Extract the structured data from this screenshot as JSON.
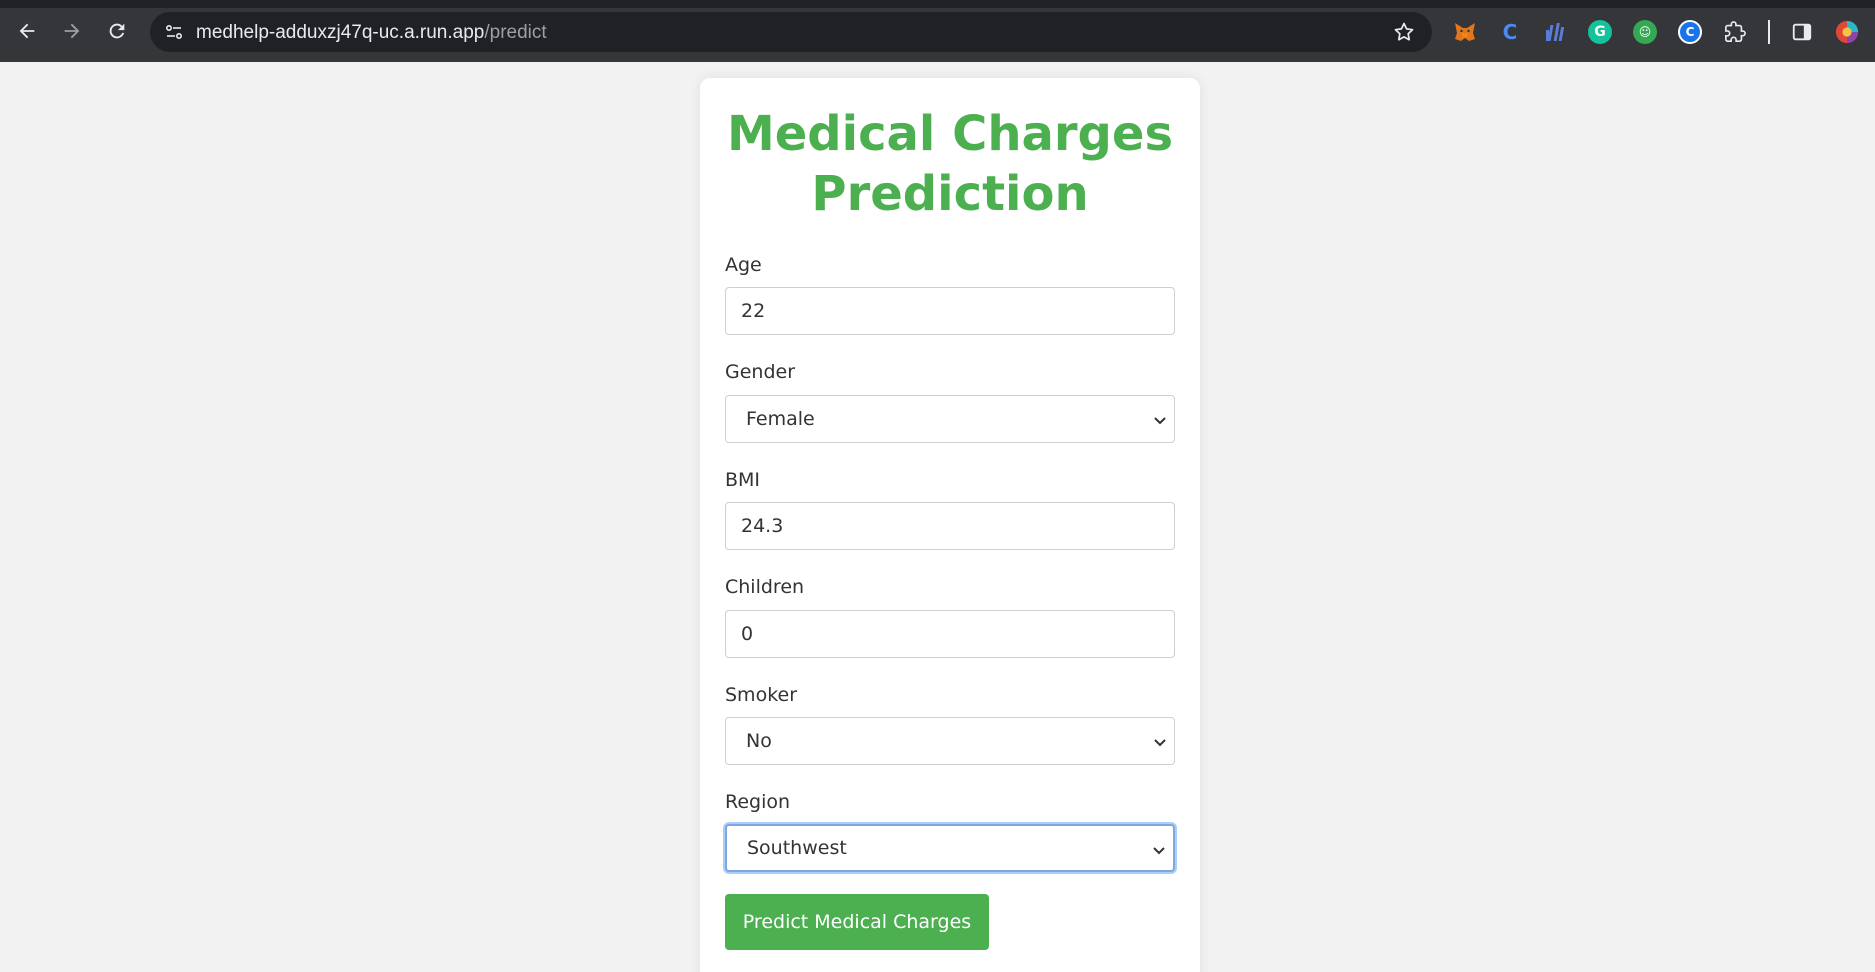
{
  "browser": {
    "url_host": "medhelp-adduxzj47q-uc.a.run.app",
    "url_path": "/predict",
    "extensions": [
      {
        "name": "metamask-icon",
        "color": "#e2761b",
        "glyph": "🦊"
      },
      {
        "name": "c-extension-icon",
        "color": "#1a73e8",
        "glyph": "C"
      },
      {
        "name": "chart-extension-icon",
        "color": "#5b7bd5",
        "glyph": "▮"
      },
      {
        "name": "grammarly-icon",
        "color": "#15c39a",
        "glyph": "G"
      },
      {
        "name": "robot-extension-icon",
        "color": "#34a853",
        "glyph": "☺"
      },
      {
        "name": "coinbase-extension-icon",
        "color": "#1a73e8",
        "glyph": "C"
      }
    ]
  },
  "form": {
    "title": "Medical Charges Prediction",
    "fields": {
      "age": {
        "label": "Age",
        "value": "22"
      },
      "gender": {
        "label": "Gender",
        "value": "Female"
      },
      "bmi": {
        "label": "BMI",
        "value": "24.3"
      },
      "children": {
        "label": "Children",
        "value": "0"
      },
      "smoker": {
        "label": "Smoker",
        "value": "No"
      },
      "region": {
        "label": "Region",
        "value": "Southwest"
      }
    },
    "submit_label": "Predict Medical Charges"
  },
  "colors": {
    "accent": "#4caf50",
    "page_bg": "#f2f2f2",
    "browser_bar": "#35363a"
  }
}
